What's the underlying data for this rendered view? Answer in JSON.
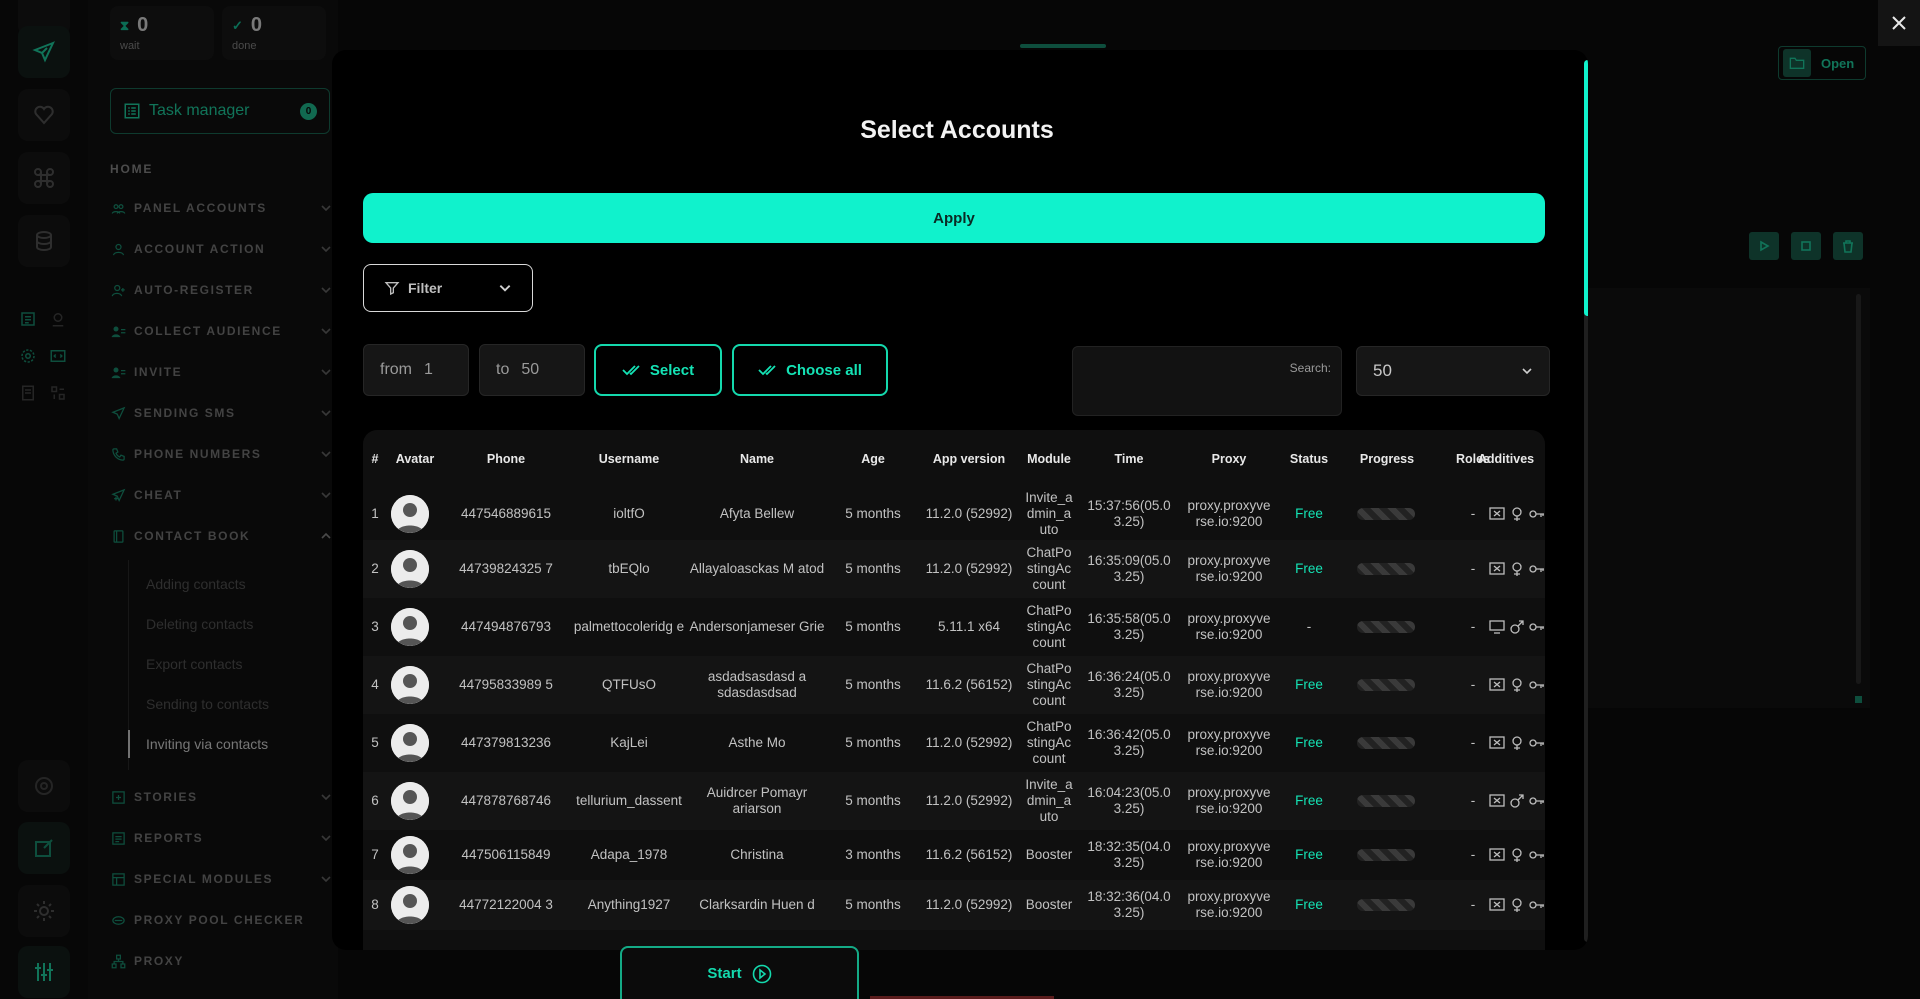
{
  "counters": [
    {
      "value": "0",
      "label": "wait",
      "icon": "hourglass-icon"
    },
    {
      "value": "0",
      "label": "done",
      "icon": "check-circle-icon"
    }
  ],
  "task_manager": {
    "label": "Task manager",
    "badge": "0"
  },
  "nav": {
    "home": "HOME",
    "items": [
      {
        "label": "PANEL ACCOUNTS",
        "icon": "users-icon"
      },
      {
        "label": "ACCOUNT ACTION",
        "icon": "user-icon"
      },
      {
        "label": "AUTO-REGISTER",
        "icon": "user-plus-icon"
      },
      {
        "label": "COLLECT AUDIENCE",
        "icon": "user-list-icon"
      },
      {
        "label": "INVITE",
        "icon": "user-list-icon"
      },
      {
        "label": "SENDING SMS",
        "icon": "send-icon"
      },
      {
        "label": "PHONE NUMBERS",
        "icon": "phone-icon"
      },
      {
        "label": "CHEAT",
        "icon": "send-plus-icon"
      },
      {
        "label": "CONTACT BOOK",
        "icon": "book-icon"
      }
    ],
    "sub_items": [
      "Adding contacts",
      "Deleting contacts",
      "Export contacts",
      "Sending to contacts",
      "Inviting via contacts"
    ],
    "items_after": [
      {
        "label": "STORIES",
        "icon": "plus-square-icon"
      },
      {
        "label": "REPORTS",
        "icon": "report-icon"
      },
      {
        "label": "SPECIAL MODULES",
        "icon": "modules-icon"
      },
      {
        "label": "PROXY POOL CHECKER",
        "icon": "proxy-pool-icon"
      },
      {
        "label": "PROXY",
        "icon": "proxy-icon"
      }
    ]
  },
  "background": {
    "open_label": "Open"
  },
  "modal": {
    "title": "Select Accounts",
    "apply_label": "Apply",
    "filter_label": "Filter",
    "from_label": "from",
    "from_value": "1",
    "to_label": "to",
    "to_value": "50",
    "select_label": "Select",
    "choose_all_label": "Choose all",
    "search_label": "Search:",
    "per_page": "50",
    "start_label": "Start"
  },
  "table": {
    "headers": [
      "#",
      "Avatar",
      "Phone",
      "Username",
      "Name",
      "Age",
      "App version",
      "Module",
      "Time",
      "Proxy",
      "Status",
      "Progress",
      "Roles",
      "Additives"
    ],
    "rows": [
      {
        "n": "1",
        "phone": "447546889615",
        "username": "ioltfO",
        "name": "Afyta Bellew",
        "age": "5 months",
        "app": "11.2.0 (52992)",
        "module": "Invite_a dmin_a uto",
        "time": "15:37:56(05.0 3.25)",
        "proxy": "proxy.proxyve rse.io:9200",
        "status": "Free",
        "roles": "-",
        "gender": "female"
      },
      {
        "n": "2",
        "phone": "44739824325 7",
        "username": "tbEQlo",
        "name": "Allayaloasckas M atod",
        "age": "5 months",
        "app": "11.2.0 (52992)",
        "module": "ChatPo stingAc count",
        "time": "16:35:09(05.0 3.25)",
        "proxy": "proxy.proxyve rse.io:9200",
        "status": "Free",
        "roles": "-",
        "gender": "female"
      },
      {
        "n": "3",
        "phone": "447494876793",
        "username": "palmettocoleridg e",
        "name": "Andersonjameser Grie",
        "age": "5 months",
        "app": "5.11.1 x64",
        "module": "ChatPo stingAc count",
        "time": "16:35:58(05.0 3.25)",
        "proxy": "proxy.proxyve rse.io:9200",
        "status": "-",
        "roles": "-",
        "gender": "male"
      },
      {
        "n": "4",
        "phone": "44795833989 5",
        "username": "QTFUsO",
        "name": "asdadsasdasd a sdasdasdsad",
        "age": "5 months",
        "app": "11.6.2 (56152)",
        "module": "ChatPo stingAc count",
        "time": "16:36:24(05.0 3.25)",
        "proxy": "proxy.proxyve rse.io:9200",
        "status": "Free",
        "roles": "-",
        "gender": "female"
      },
      {
        "n": "5",
        "phone": "447379813236",
        "username": "KajLei",
        "name": "Asthe Mo",
        "age": "5 months",
        "app": "11.2.0 (52992)",
        "module": "ChatPo stingAc count",
        "time": "16:36:42(05.0 3.25)",
        "proxy": "proxy.proxyve rse.io:9200",
        "status": "Free",
        "roles": "-",
        "gender": "female"
      },
      {
        "n": "6",
        "phone": "447878768746",
        "username": "tellurium_dassent",
        "name": "Auidrcer Pomayr ariarson",
        "age": "5 months",
        "app": "11.2.0 (52992)",
        "module": "Invite_a dmin_a uto",
        "time": "16:04:23(05.0 3.25)",
        "proxy": "proxy.proxyve rse.io:9200",
        "status": "Free",
        "roles": "-",
        "gender": "male"
      },
      {
        "n": "7",
        "phone": "447506115849",
        "username": "Adapa_1978",
        "name": "Christina",
        "age": "3 months",
        "app": "11.6.2 (56152)",
        "module": "Booster",
        "time": "18:32:35(04.0 3.25)",
        "proxy": "proxy.proxyve rse.io:9200",
        "status": "Free",
        "roles": "-",
        "gender": "female"
      },
      {
        "n": "8",
        "phone": "44772122004 3",
        "username": "Anything1927",
        "name": "Clarksardin Huen d",
        "age": "5 months",
        "app": "11.2.0 (52992)",
        "module": "Booster",
        "time": "18:32:36(04.0 3.25)",
        "proxy": "proxy.proxyve rse.io:9200",
        "status": "Free",
        "roles": "-",
        "gender": "female"
      }
    ]
  },
  "colors": {
    "accent": "#10f2cc",
    "accent_dark": "#1b6a55",
    "free": "#14e3b5"
  }
}
